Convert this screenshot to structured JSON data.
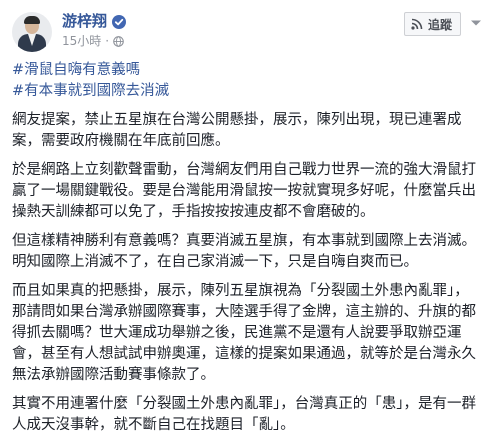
{
  "post": {
    "author": "游梓翔",
    "time": "15小時",
    "follow_label": "追蹤",
    "hashtags": [
      "#滑鼠自嗨有意義嗎",
      "#有本事就到國際去消滅"
    ],
    "paragraphs": [
      "網友提案，禁止五星旗在台灣公開懸掛，展示，陳列出現，現已連署成案，需要政府機關在年底前回應。",
      "於是網路上立刻歡聲雷動，台灣網友們用自己戰力世界一流的強大滑鼠打贏了一場關鍵戰役。要是台灣能用滑鼠按一按就實現多好呢，什麼當兵出操熱天訓練都可以免了，手指按按按連皮都不會磨破的。",
      "但這樣精神勝利有意義嗎？真要消滅五星旗，有本事就到國際上去消滅。明知國際上消滅不了，在自己家消滅一下，只是自嗨自爽而已。",
      "而且如果真的把懸掛，展示，陳列五星旗視為「分裂國土外患內亂罪」，那請問如果台灣承辦國際賽事，大陸選手得了金牌，這主辦的、升旗的都得抓去關嗎？世大運成功舉辦之後，民進黨不是還有人說要爭取辦亞運會，甚至有人想試試申辦奧運，這樣的提案如果通過，就等於是台灣永久無法承辦國際活動賽事條款了。",
      "其實不用連署什麼「分裂國土外患內亂罪」，台灣真正的「患」，是有一群人成天沒事幹，就不斷自己在找題目「亂」。"
    ]
  },
  "icons": {
    "verified": "verified-badge-icon",
    "privacy": "globe-icon",
    "follow": "rss-feed-icon",
    "more": "more-options-icon"
  },
  "colors": {
    "link": "#365899",
    "verified": "#4267b2",
    "meta_text": "#90949c",
    "body_text": "#1d2129"
  }
}
